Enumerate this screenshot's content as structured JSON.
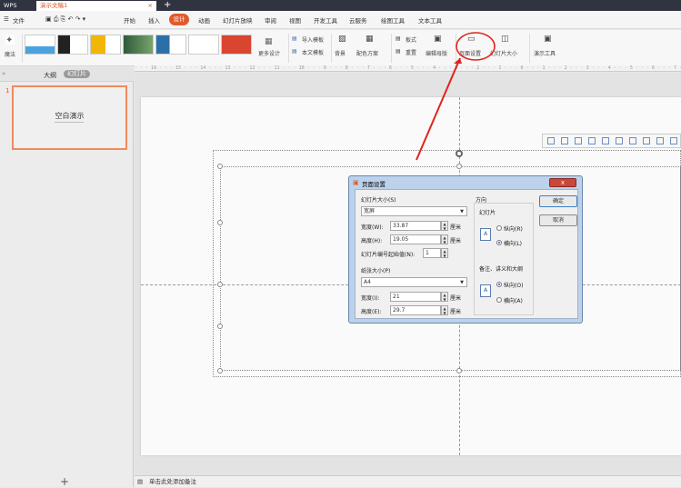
{
  "titlebar": {
    "app": "WPS",
    "doc_tab": "演示文稿1",
    "close": "×",
    "add": "+"
  },
  "menubar": {
    "file": "文件",
    "items": [
      "开始",
      "插入",
      "设计",
      "动画",
      "幻灯片放映",
      "审阅",
      "视图",
      "开发工具",
      "云服务",
      "绘图工具",
      "文本工具"
    ],
    "active": "设计"
  },
  "ribbon": {
    "magic": "魔法",
    "more_designs": "更多设计",
    "import_template": "导入模板",
    "text_template": "本文模板",
    "background": "背景",
    "color_scheme": "配色方案",
    "layout": "板式",
    "rearrange": "重置",
    "edit_master": "编辑母版",
    "page_setup": "页面设置",
    "slide_size": "幻灯片大小",
    "present_tools": "演示工具"
  },
  "left_panel": {
    "tab_outline": "大纲",
    "tab_slides": "幻灯片",
    "slide_number": "1",
    "slide_title": "空白演示",
    "add": "+"
  },
  "ruler": "· · · 16 · · · 15 · · · 14 · · · 13 · · · 12 · · · 11 · · · 10 · · · 9 · · · 8 · · · 7 · · · 6 · · · 5 · · · 4 · · · 3 · · · 2 · · · 1 · · · 0 · · · 1 · · · 2 · · · 3 · · · 4 · · · 5 · · · 6 · · · 7 · · · 8 · · · 9 · · · 10 · · · 11",
  "statusbar": {
    "notes": "单击此处添加备注"
  },
  "dialog": {
    "title": "页面设置",
    "close": "x",
    "slide_size_label": "幻灯片大小(S)",
    "slide_size_value": "宽屏",
    "width_label": "宽度(W):",
    "width_value": "33.87",
    "height_label": "高度(H):",
    "height_value": "19.05",
    "unit": "厘米",
    "start_num_label": "幻灯片编号起始值(N):",
    "start_num_value": "1",
    "paper_size_label": "纸张大小(P)",
    "paper_size_value": "A4",
    "paper_width_label": "宽度(I):",
    "paper_width_value": "21",
    "paper_height_label": "高度(E):",
    "paper_height_value": "29.7",
    "orientation_label": "方向",
    "slides_label": "幻灯片",
    "portrait_label": "纵向(R)",
    "landscape_label": "横向(L)",
    "notes_label": "备注、讲义和大纲",
    "notes_portrait_label": "纵向(O)",
    "notes_landscape_label": "横向(A)",
    "ok": "确定",
    "cancel": "取消"
  },
  "colors": {
    "accent": "#e2592c",
    "annotation": "#e0241b"
  }
}
